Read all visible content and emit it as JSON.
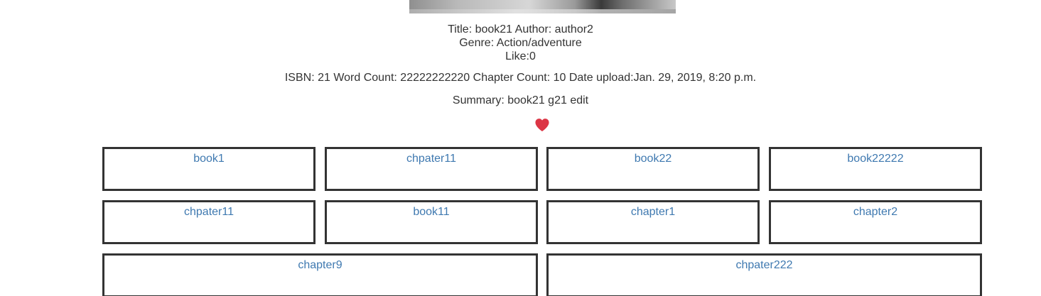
{
  "book": {
    "title_line": "Title: book21 Author: author2",
    "genre_line": "Genre: Action/adventure",
    "like_line": "Like:0",
    "meta_line": "ISBN: 21 Word Count: 22222222220 Chapter Count: 10 Date upload:Jan. 29, 2019, 8:20 p.m.",
    "summary_line": "Summary: book21 g21 edit"
  },
  "like_icon": "heart-icon",
  "colors": {
    "heart": "#dc3545",
    "link": "#3f79b0",
    "border": "#333333",
    "text": "#333333"
  },
  "chapters": [
    "book1",
    "chpater11",
    "book22",
    "book22222",
    "chpater11",
    "book11",
    "chapter1",
    "chapter2",
    "chapter9",
    "chpater222"
  ]
}
